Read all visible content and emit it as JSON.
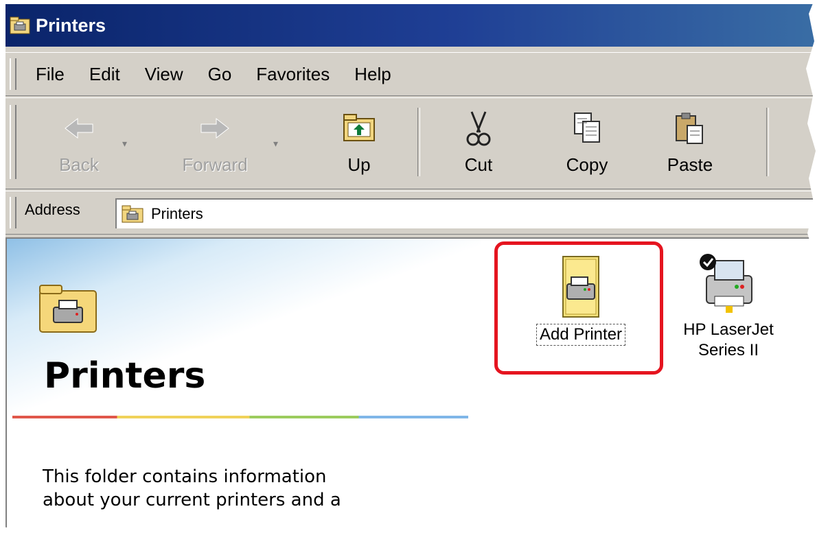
{
  "window": {
    "title": "Printers",
    "icon": "printers-folder-icon"
  },
  "menu": [
    "File",
    "Edit",
    "View",
    "Go",
    "Favorites",
    "Help"
  ],
  "toolbar": {
    "back": {
      "label": "Back",
      "icon": "back-arrow-icon",
      "enabled": false
    },
    "forward": {
      "label": "Forward",
      "icon": "forward-arrow-icon",
      "enabled": false
    },
    "up": {
      "label": "Up",
      "icon": "up-folder-icon"
    },
    "cut": {
      "label": "Cut",
      "icon": "scissors-icon"
    },
    "copy": {
      "label": "Copy",
      "icon": "copy-icon"
    },
    "paste": {
      "label": "Paste",
      "icon": "paste-icon"
    }
  },
  "address": {
    "label": "Address",
    "value": "Printers",
    "icon": "printers-folder-icon"
  },
  "webview": {
    "title": "Printers",
    "description_line1": "This folder contains information",
    "description_line2": "about your current printers and a"
  },
  "items": [
    {
      "label": "Add Printer",
      "icon": "add-printer-icon",
      "highlighted": true
    },
    {
      "label_line1": "HP LaserJet",
      "label_line2": "Series II",
      "icon": "printer-icon",
      "default": true
    }
  ],
  "colors": {
    "titlebar": "#0a246a",
    "chrome": "#d4d0c8",
    "highlight": "#e5141f"
  }
}
